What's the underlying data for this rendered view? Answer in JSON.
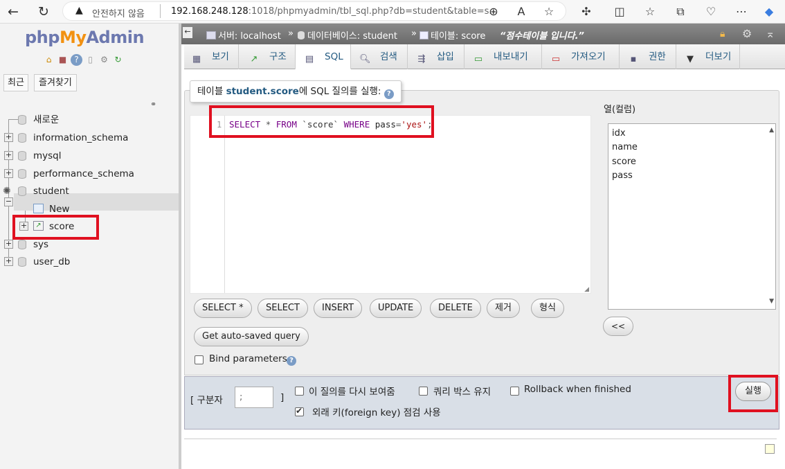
{
  "browser": {
    "insecure_label": "안전하지 않음",
    "url_host": "192.168.248.128",
    "url_rest": ":1018/phpmyadmin/tbl_sql.php?db=student&table=s..."
  },
  "nav": {
    "logo_php": "php",
    "logo_my": "My",
    "logo_admin": "Admin",
    "recent_label": "최근",
    "favorites_label": "즐겨찾기",
    "tree": {
      "new_label": "새로운",
      "dbs": [
        "information_schema",
        "mysql",
        "performance_schema",
        "student",
        "sys",
        "user_db"
      ],
      "student_children": [
        "New",
        "score"
      ]
    }
  },
  "breadcrumb": {
    "server": "서버: localhost",
    "sep1": "»",
    "database": "데이터베이스: student",
    "sep2": "»",
    "table": "테이블: score",
    "comment": "“점수테이블 입니다.”"
  },
  "tabs": [
    {
      "label": "보기",
      "icon": "browse-icon"
    },
    {
      "label": "구조",
      "icon": "structure-icon"
    },
    {
      "label": "SQL",
      "icon": "sql-icon"
    },
    {
      "label": "검색",
      "icon": "search-icon"
    },
    {
      "label": "삽입",
      "icon": "insert-icon"
    },
    {
      "label": "내보내기",
      "icon": "export-icon"
    },
    {
      "label": "가져오기",
      "icon": "import-icon"
    },
    {
      "label": "권한",
      "icon": "privileges-icon"
    },
    {
      "label": "더보기",
      "icon": "more-icon"
    }
  ],
  "query_box": {
    "legend_prefix": "테이블 ",
    "legend_table": "student.score",
    "legend_suffix": "에 SQL 질의를 실행:",
    "line_number": "1",
    "code": {
      "select": "SELECT",
      "star": "*",
      "from": "FROM",
      "table": "`score`",
      "where": "WHERE",
      "field": "pass",
      "eq": "=",
      "value": "'yes'",
      "end": ";"
    },
    "buttons": [
      "SELECT *",
      "SELECT",
      "INSERT",
      "UPDATE",
      "DELETE",
      "제거",
      "형식"
    ],
    "autosave_label": "Get auto-saved query",
    "bind_params_label": "Bind parameters"
  },
  "columns": {
    "label": "열(컬럼)",
    "items": [
      "idx",
      "name",
      "score",
      "pass"
    ],
    "insert_label": "<<"
  },
  "footer": {
    "delimiter_label": "[ 구분자",
    "delimiter_value": ";",
    "delimiter_close": "]",
    "show_again_label": "이 질의를 다시 보여줌",
    "retain_box_label": "쿼리 박스 유지",
    "rollback_label": "Rollback when finished",
    "fk_check_label": "외래 키(foreign key) 점검 사용",
    "go_label": "실행"
  }
}
